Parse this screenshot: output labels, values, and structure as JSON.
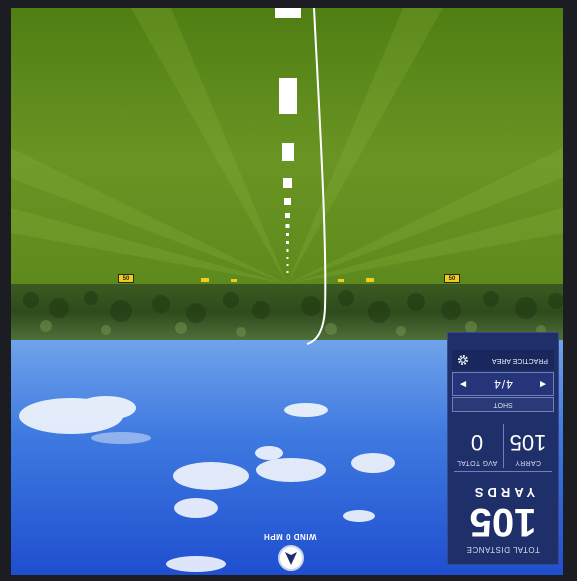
{
  "stats": {
    "total_distance_label": "TOTAL DISTANCE",
    "total_distance_value": "105",
    "total_distance_unit": "YARDS",
    "carry_label": "CARRY",
    "carry_value": "105",
    "avg_total_label": "AVG TOTAL",
    "avg_total_value": "0",
    "shot_label": "SHOT",
    "shot_value": "4/4",
    "area_label": "PRACTICE AREA"
  },
  "wind": {
    "label": "WIND 0 MPH"
  },
  "range": {
    "yard_markers": [
      "50",
      "50"
    ]
  },
  "colors": {
    "panel_bg": "#1f2f6a",
    "fairway": "#5f8d1c",
    "sky": "#2e69d8",
    "marker": "#f0cc1c"
  },
  "icons": {
    "settings": "gear-icon",
    "wind_direction": "arrow-icon"
  }
}
